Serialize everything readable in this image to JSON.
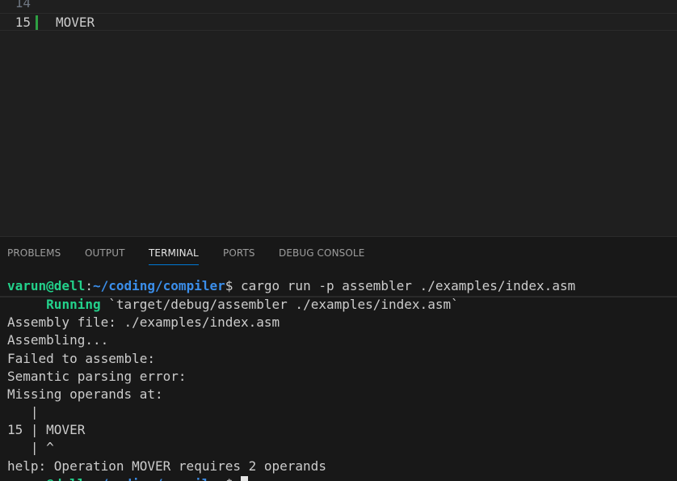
{
  "editor": {
    "lines": [
      {
        "number": "14",
        "text": ""
      },
      {
        "number": "15",
        "text": "MOVER"
      }
    ]
  },
  "panel": {
    "tabs": [
      {
        "label": "PROBLEMS",
        "active": false
      },
      {
        "label": "OUTPUT",
        "active": false
      },
      {
        "label": "TERMINAL",
        "active": true
      },
      {
        "label": "PORTS",
        "active": false
      },
      {
        "label": "DEBUG CONSOLE",
        "active": false
      }
    ]
  },
  "terminal": {
    "prompt_user": "varun@dell",
    "prompt_colon": ":",
    "prompt_path": "~/coding/compiler",
    "prompt_symbol": "$ ",
    "command": "cargo run -p assembler ./examples/index.asm",
    "running_label": "Running",
    "running_text": " `target/debug/assembler ./examples/index.asm`",
    "output_lines": [
      "Assembly file: ./examples/index.asm",
      "Assembling...",
      "Failed to assemble:",
      "Semantic parsing error:",
      "Missing operands at:",
      "   |",
      "15 | MOVER",
      "   | ^",
      "help: Operation MOVER requires 2 operands"
    ]
  },
  "colors": {
    "prompt_user": "#23d18b",
    "prompt_path": "#3b8eea",
    "active_tab_underline": "#0078d4",
    "gutter_added": "#2ea043"
  }
}
